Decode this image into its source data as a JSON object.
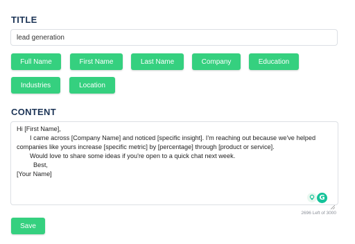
{
  "title_section": {
    "label": "TITLE",
    "value": "lead generation"
  },
  "placeholders": [
    {
      "label": "Full Name"
    },
    {
      "label": "First Name"
    },
    {
      "label": "Last Name"
    },
    {
      "label": "Company"
    },
    {
      "label": "Education"
    },
    {
      "label": "Industries"
    },
    {
      "label": "Location"
    }
  ],
  "content_section": {
    "label": "CONTENT",
    "lines": [
      "Hi [First Name],",
      "I came across [Company Name] and noticed [specific insight]. I'm reaching out because we've helped",
      "companies like yours increase [specific metric] by [percentage] through [product or service].",
      "Would love to share some ideas if you're open to a quick chat next week.",
      "Best,",
      "[Your Name]"
    ],
    "char_count": "2696 Left of 3000"
  },
  "actions": {
    "save_label": "Save"
  },
  "colors": {
    "accent": "#35d07f",
    "heading": "#1d3557",
    "grammarly": "#15c39a"
  }
}
